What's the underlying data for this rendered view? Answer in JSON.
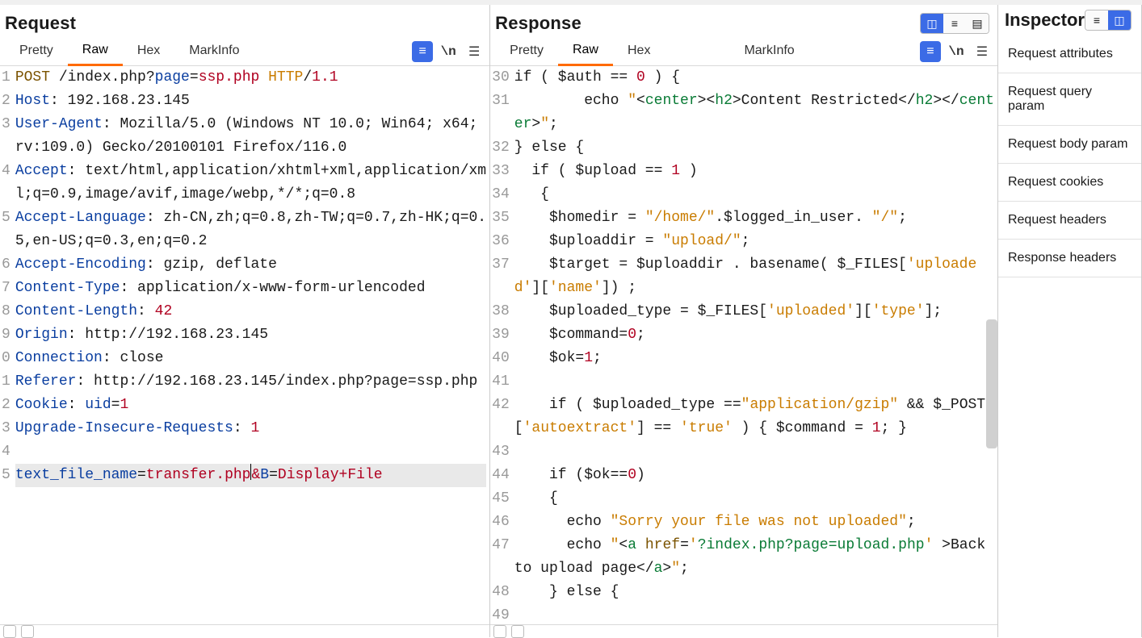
{
  "request": {
    "title": "Request",
    "tabs": [
      "Pretty",
      "Raw",
      "Hex",
      "MarkInfo"
    ],
    "activeTab": 1,
    "icons": {
      "wrap": "\\n"
    },
    "lines": [
      {
        "n": 1,
        "html": "<span class='c-func'>POST</span> /index.php?<span class='c-hdr'>page</span>=<span class='c-val'>ssp.php</span> <span class='c-str'>HTTP</span>/<span class='c-val'>1.1</span>"
      },
      {
        "n": 2,
        "html": "<span class='c-hdr'>Host</span>: 192.168.23.145"
      },
      {
        "n": 3,
        "html": "<span class='c-hdr'>User-Agent</span>: Mozilla/5.0 (Windows NT 10.0; Win64; x64; rv:109.0) Gecko/20100101 Firefox/116.0"
      },
      {
        "n": 4,
        "html": "<span class='c-hdr'>Accept</span>: text/html,application/xhtml+xml,application/xml;q=0.9,image/avif,image/webp,*/*;q=0.8"
      },
      {
        "n": 5,
        "html": "<span class='c-hdr'>Accept-Language</span>: zh-CN,zh;q=0.8,zh-TW;q=0.7,zh-HK;q=0.5,en-US;q=0.3,en;q=0.2"
      },
      {
        "n": 6,
        "html": "<span class='c-hdr'>Accept-Encoding</span>: gzip, deflate"
      },
      {
        "n": 7,
        "html": "<span class='c-hdr'>Content-Type</span>: application/x-www-form-urlencoded"
      },
      {
        "n": 8,
        "html": "<span class='c-hdr'>Content-Length</span>: <span class='c-val'>42</span>"
      },
      {
        "n": 9,
        "html": "<span class='c-hdr'>Origin</span>: http://192.168.23.145"
      },
      {
        "n": 0,
        "html": "<span class='c-hdr'>Connection</span>: close"
      },
      {
        "n": 1,
        "html": "<span class='c-hdr'>Referer</span>: http://192.168.23.145/index.php?page=ssp.php"
      },
      {
        "n": 2,
        "html": "<span class='c-hdr'>Cookie</span>: <span class='c-hdr'>uid</span>=<span class='c-val'>1</span>"
      },
      {
        "n": 3,
        "html": "<span class='c-hdr'>Upgrade-Insecure-Requests</span>: <span class='c-val'>1</span>"
      },
      {
        "n": 4,
        "html": "&nbsp;"
      },
      {
        "n": 5,
        "active": true,
        "html": "<span class='c-hdr'>text_file_name</span>=<span class='c-val'>transfer.php</span><span class='cursor'></span><span class='c-amp'>&amp;</span><span class='c-hdr'>B</span>=<span class='c-val'>Display+File</span>"
      }
    ]
  },
  "response": {
    "title": "Response",
    "tabs": [
      "Pretty",
      "Raw",
      "Hex",
      "MarkInfo"
    ],
    "activeTab": 1,
    "lines": [
      {
        "n": 30,
        "html": "if ( $auth == <span class='c-num'>0</span> ) {"
      },
      {
        "n": 31,
        "html": "&nbsp;&nbsp;&nbsp;&nbsp;&nbsp;&nbsp;&nbsp;&nbsp;echo <span class='c-str'>\"</span>&lt;<span class='c-tag'>center</span>&gt;&lt;<span class='c-tag'>h2</span>&gt;Content Restricted&lt;/<span class='c-tag'>h2</span>&gt;&lt;/<span class='c-tag'>center</span>&gt;<span class='c-str'>\"</span>;"
      },
      {
        "n": 32,
        "html": "} else {"
      },
      {
        "n": 33,
        "html": "&nbsp;&nbsp;if ( $upload == <span class='c-num'>1</span> )"
      },
      {
        "n": 34,
        "html": "&nbsp;&nbsp;&nbsp;{"
      },
      {
        "n": 35,
        "html": "&nbsp;&nbsp;&nbsp;&nbsp;$homedir = <span class='c-str'>\"/home/\"</span>.$logged_in_user.<span class='c-str'> \"/\"</span>;"
      },
      {
        "n": 36,
        "html": "&nbsp;&nbsp;&nbsp;&nbsp;$uploaddir = <span class='c-str'>\"upload/\"</span>;"
      },
      {
        "n": 37,
        "html": "&nbsp;&nbsp;&nbsp;&nbsp;$target = $uploaddir . basename( $_FILES[<span class='c-str'>'uploaded'</span>][<span class='c-str'>'name'</span>]) ;"
      },
      {
        "n": 38,
        "html": "&nbsp;&nbsp;&nbsp;&nbsp;$uploaded_type = $_FILES[<span class='c-str'>'uploaded'</span>][<span class='c-str'>'type'</span>];"
      },
      {
        "n": 39,
        "html": "&nbsp;&nbsp;&nbsp;&nbsp;$command=<span class='c-num'>0</span>;"
      },
      {
        "n": 40,
        "html": "&nbsp;&nbsp;&nbsp;&nbsp;$ok=<span class='c-num'>1</span>;"
      },
      {
        "n": 41,
        "html": "&nbsp;"
      },
      {
        "n": 42,
        "html": "&nbsp;&nbsp;&nbsp;&nbsp;if ( $uploaded_type ==<span class='c-str'>\"application/gzip\"</span> &amp;&amp; $_POST[<span class='c-str'>'autoextract'</span>] == <span class='c-str'>'true'</span> ) { $command = <span class='c-num'>1</span>; }"
      },
      {
        "n": 43,
        "html": "&nbsp;"
      },
      {
        "n": 44,
        "html": "&nbsp;&nbsp;&nbsp;&nbsp;if ($ok==<span class='c-num'>0</span>)"
      },
      {
        "n": 45,
        "html": "&nbsp;&nbsp;&nbsp;&nbsp;{"
      },
      {
        "n": 46,
        "html": "&nbsp;&nbsp;&nbsp;&nbsp;&nbsp;&nbsp;echo <span class='c-str'>\"Sorry your file was not uploaded\"</span>;"
      },
      {
        "n": 47,
        "html": "&nbsp;&nbsp;&nbsp;&nbsp;&nbsp;&nbsp;echo <span class='c-str'>\"</span>&lt;<span class='c-tag'>a</span> <span class='c-attr'>href</span>=<span class='c-str'>'</span><span class='c-green'>?index.php?page=upload.php</span><span class='c-str'>'</span> &gt;Back to upload page&lt;/<span class='c-tag'>a</span>&gt;<span class='c-str'>\"</span>;"
      },
      {
        "n": 48,
        "html": "&nbsp;&nbsp;&nbsp;&nbsp;} else {"
      },
      {
        "n": 49,
        "html": "&nbsp;"
      }
    ]
  },
  "inspector": {
    "title": "Inspector",
    "items": [
      "Request attributes",
      "Request query param",
      "Request body param",
      "Request cookies",
      "Request headers",
      "Response headers"
    ]
  },
  "icons": {
    "wrapBtn": "\\n"
  }
}
